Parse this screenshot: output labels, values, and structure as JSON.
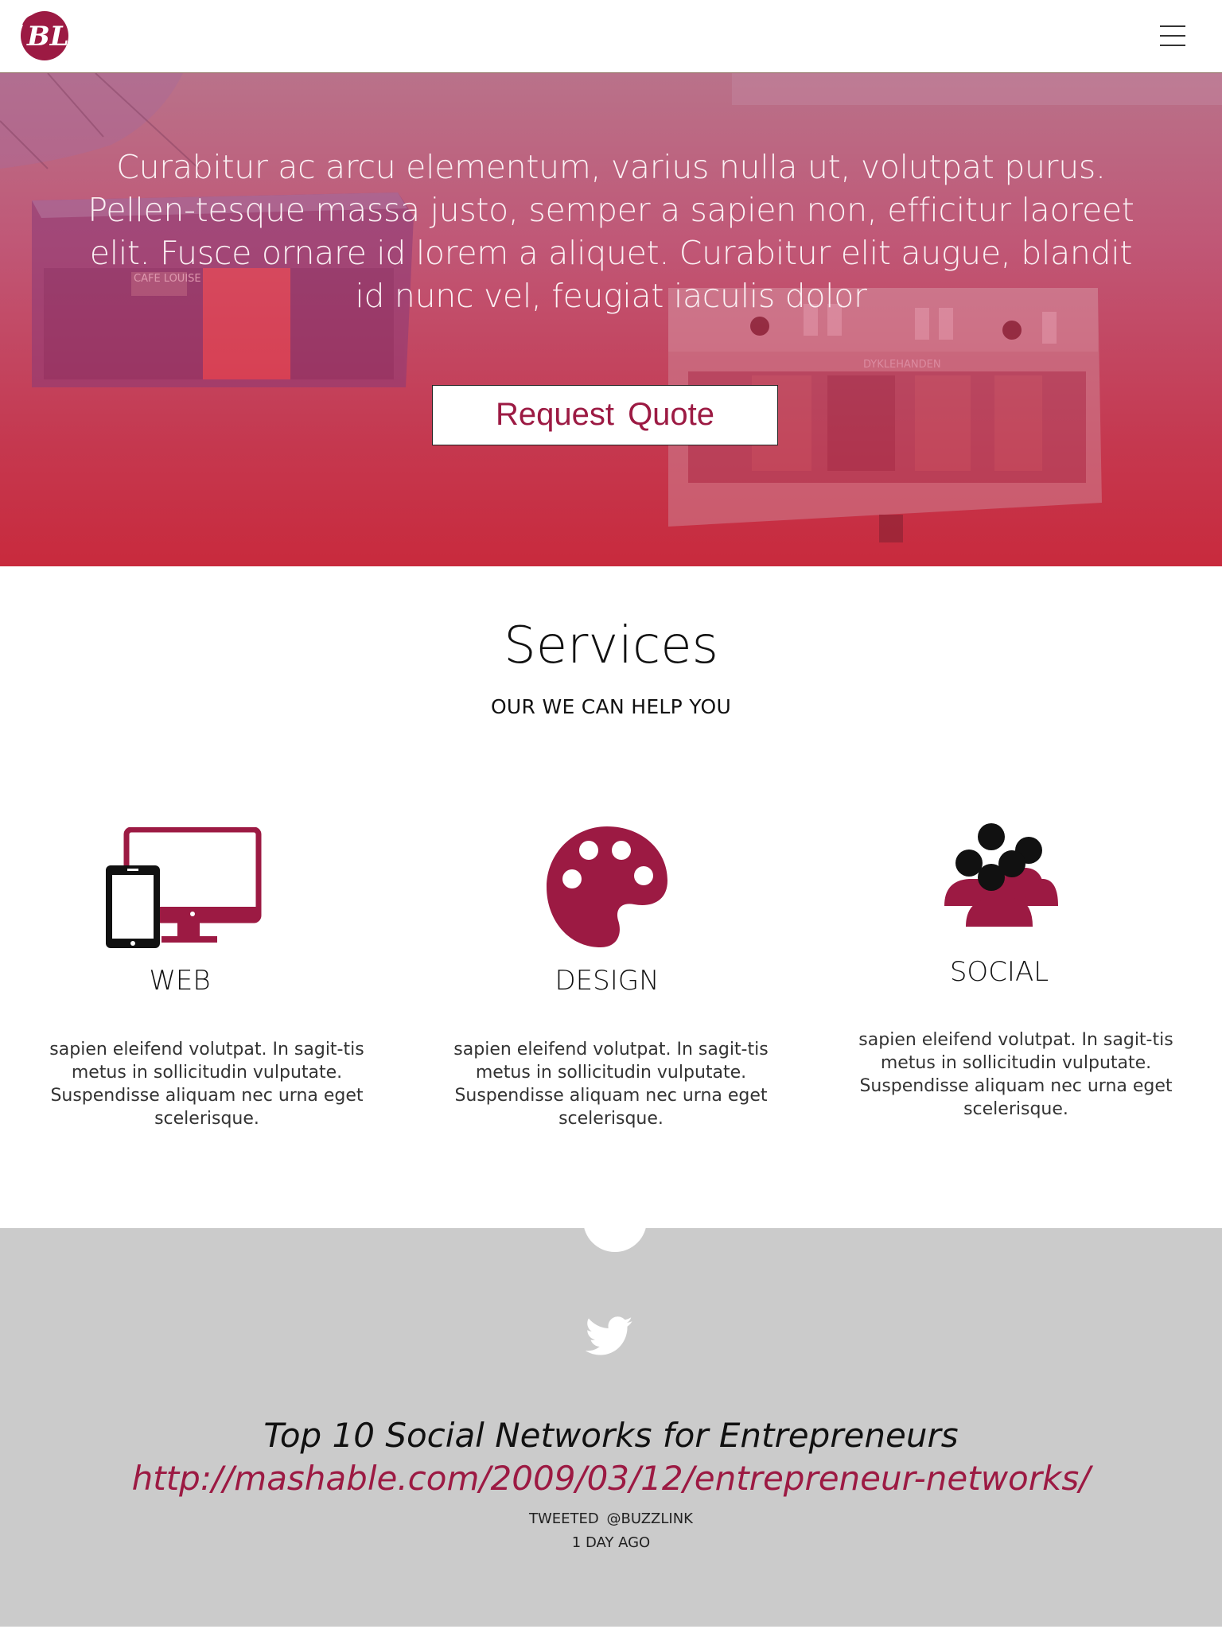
{
  "header": {
    "logo_text": "BL",
    "logo_icon": "bl-monogram-logo",
    "menu_icon": "hamburger-menu-icon"
  },
  "hero": {
    "tagline": "Curabitur ac arcu elementum, varius nulla ut, volutpat purus. Pellen-tesque massa justo, semper a sapien non, efficitur laoreet elit. Fusce ornare id lorem a aliquet. Curabitur elit augue, blandit id nunc vel, feugiat iaculis dolor",
    "cta_label": "Request  Quote",
    "background_signs": [
      "CAFE LOUISE",
      "DYKLEHANDEN"
    ]
  },
  "services": {
    "title": "Services",
    "subtitle": "OUR WE CAN HELP YOU",
    "items": [
      {
        "label": "WEB",
        "icon": "devices-icon",
        "description": "sapien eleifend volutpat. In sagit-tis metus in sollicitudin vulputate. Suspendisse aliquam nec urna eget scelerisque."
      },
      {
        "label": "DESIGN",
        "icon": "palette-icon",
        "description": "sapien eleifend volutpat. In sagit-tis metus in sollicitudin vulputate. Suspendisse aliquam nec urna eget scelerisque."
      },
      {
        "label": "SOCIAL",
        "icon": "people-group-icon",
        "description": "sapien eleifend volutpat. In sagit-tis metus in sollicitudin vulputate. Suspendisse aliquam nec urna eget scelerisque."
      }
    ]
  },
  "twitter": {
    "icon": "twitter-bird-icon",
    "tweet_title": "Top 10 Social Networks for Entrepreneurs",
    "tweet_link": "http://mashable.com/2009/03/12/entrepreneur-networks/",
    "tweeted_by": "TWEETED  @BUZZLINK",
    "time_ago": "1 DAY AGO"
  },
  "colors": {
    "brand": "#9c1a43",
    "hero_top": "#b9728a",
    "hero_bottom": "#c82a3d",
    "tweet_bg": "#cbcbcb"
  }
}
